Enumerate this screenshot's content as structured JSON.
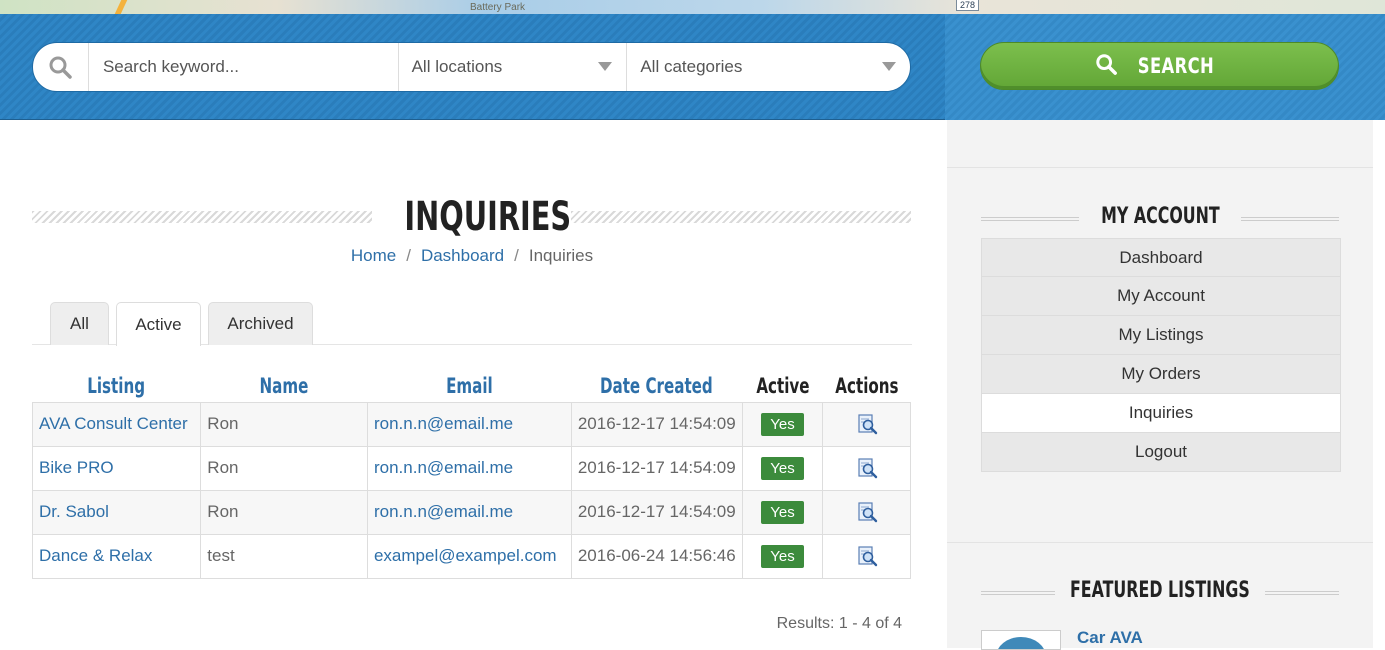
{
  "map": {
    "labels": [
      "Battery Park"
    ],
    "route_shield": "278"
  },
  "search": {
    "placeholder": "Search keyword...",
    "location": "All locations",
    "category": "All categories",
    "button_label": "SEARCH"
  },
  "page": {
    "title": "INQUIRIES",
    "breadcrumb": [
      "Home",
      "Dashboard",
      "Inquiries"
    ]
  },
  "tabs": [
    "All",
    "Active",
    "Archived"
  ],
  "table": {
    "headers": [
      "Listing",
      "Name",
      "Email",
      "Date Created",
      "Active",
      "Actions"
    ],
    "rows": [
      {
        "listing": "AVA Consult Center",
        "name": "Ron",
        "email": "ron.n.n@email.me",
        "date": "2016-12-17 14:54:09",
        "active": "Yes"
      },
      {
        "listing": "Bike PRO",
        "name": "Ron",
        "email": "ron.n.n@email.me",
        "date": "2016-12-17 14:54:09",
        "active": "Yes"
      },
      {
        "listing": "Dr. Sabol",
        "name": "Ron",
        "email": "ron.n.n@email.me",
        "date": "2016-12-17 14:54:09",
        "active": "Yes"
      },
      {
        "listing": "Dance & Relax",
        "name": "test",
        "email": "exampel@exampel.com",
        "date": "2016-06-24 14:56:46",
        "active": "Yes"
      }
    ]
  },
  "results": "Results: 1 - 4 of 4",
  "sidebar": {
    "account_title": "MY ACCOUNT",
    "menu": [
      "Dashboard",
      "My Account",
      "My Listings",
      "My Orders",
      "Inquiries",
      "Logout"
    ],
    "selected": "Inquiries",
    "featured_title": "FEATURED LISTINGS",
    "featured_item": "Car AVA"
  },
  "colors": {
    "header_blue": "#2f86c6",
    "search_green": "#6ab23f",
    "link_blue": "#2e6fa8",
    "badge_green": "#3c8b3c"
  },
  "icons": [
    "search-icon",
    "view-inquiry-icon",
    "caret-down-icon"
  ]
}
